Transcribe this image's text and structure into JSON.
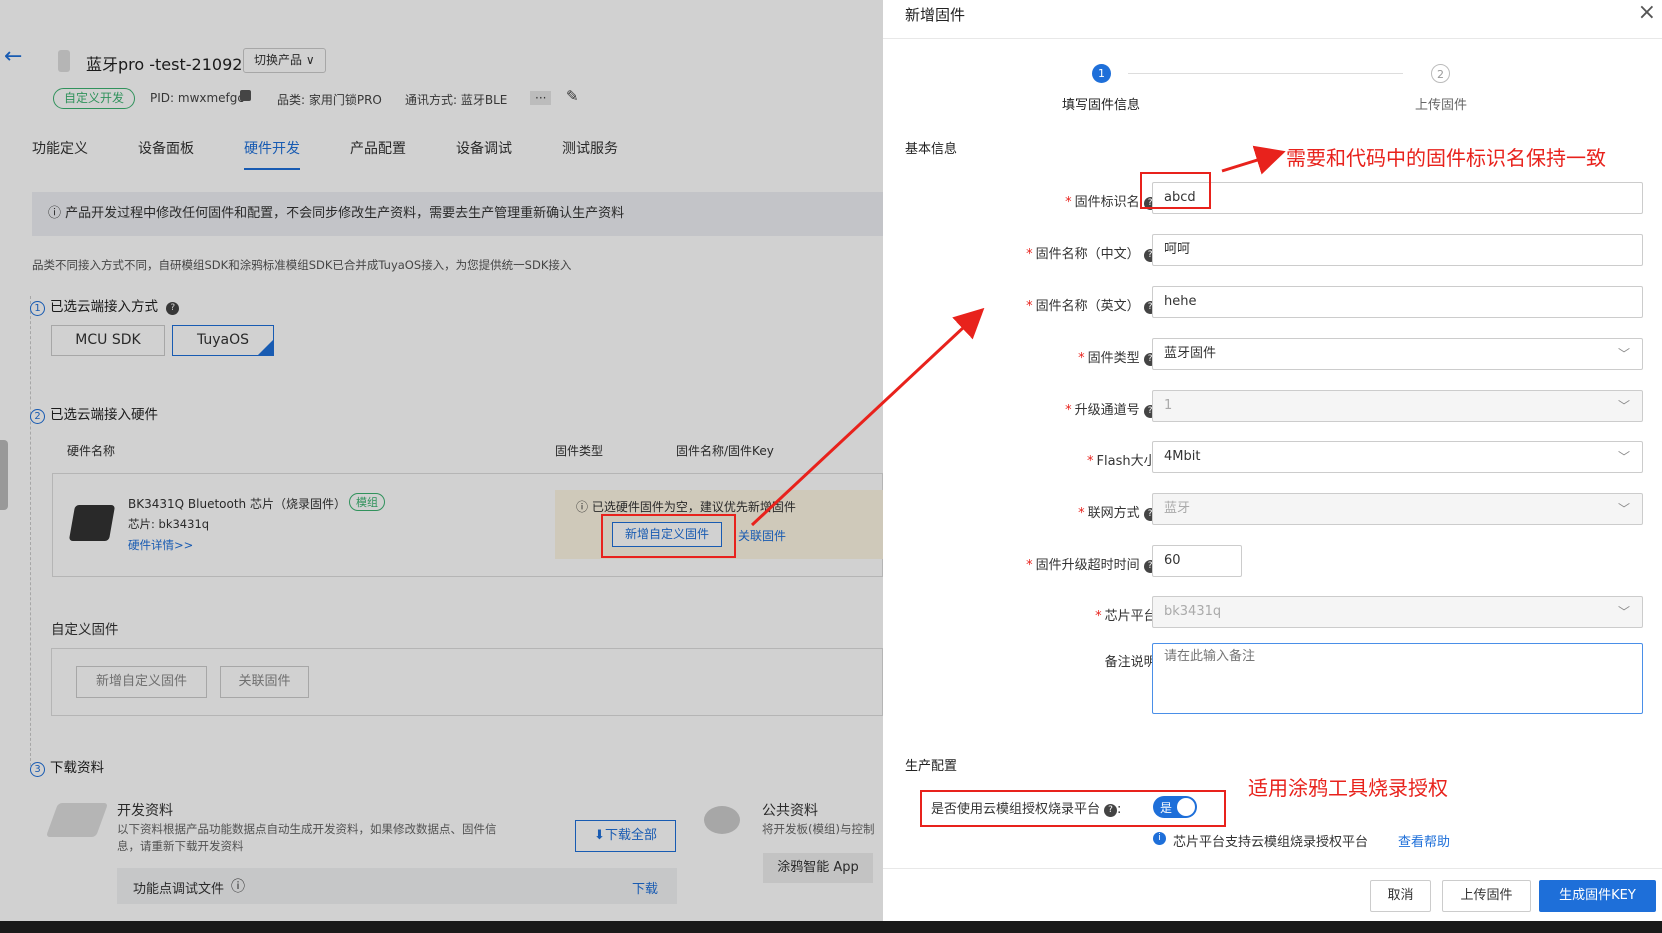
{
  "product": {
    "title": "蓝牙pro -test-210927",
    "switch_label": "切换产品 ∨",
    "tag": "自定义开发",
    "pid": "PID: mwxmefgc",
    "category": "品类: 家用门锁PRO",
    "comm": "通讯方式: 蓝牙BLE",
    "more": "···"
  },
  "tabs": [
    "功能定义",
    "设备面板",
    "硬件开发",
    "产品配置",
    "设备调试",
    "测试服务"
  ],
  "notice": "产品开发过程中修改任何固件和配置，不会同步修改生产资料，需要去生产管理重新确认生产资料",
  "subtitle": "品类不同接入方式不同，自研模组SDK和涂鸦标准模组SDK已合并成TuyaOS接入，为您提供统一SDK接入",
  "step1": {
    "num": "1",
    "label": "已选云端接入方式",
    "options": [
      "MCU SDK",
      "TuyaOS"
    ]
  },
  "step2": {
    "num": "2",
    "label": "已选云端接入硬件",
    "cols": [
      "硬件名称",
      "固件类型",
      "固件名称/固件Key"
    ],
    "hw": {
      "name": "BK3431Q Bluetooth 芯片（烧录固件）",
      "tag": "模组",
      "chip": "芯片: bk3431q",
      "detail": "硬件详情>>"
    },
    "warn": "已选硬件固件为空，建议优先新增固件",
    "add_btn": "新增自定义固件",
    "link_btn": "关联固件"
  },
  "custom": {
    "label": "自定义固件",
    "add_btn": "新增自定义固件",
    "link_btn": "关联固件"
  },
  "step3": {
    "num": "3",
    "label": "下载资料",
    "dev_title": "开发资料",
    "dev_desc1": "以下资料根据产品功能数据点自动生成开发资料，如果修改数据点、固件信",
    "dev_desc2": "息，请重新下载开发资料",
    "download_all": "⬇下载全部",
    "pub_title": "公共资料",
    "pub_desc": "将开发板(模组)与控制",
    "app": "涂鸦智能 App",
    "row_label": "功能点调试文件",
    "row_dl": "下载"
  },
  "modal": {
    "title": "新增固件",
    "close": "×",
    "steps": [
      {
        "num": "1",
        "label": "填写固件信息"
      },
      {
        "num": "2",
        "label": "上传固件"
      }
    ],
    "section1": "基本信息",
    "fields": [
      {
        "label": "固件标识名",
        "value": "abcd",
        "req": true,
        "help": true,
        "type": "input"
      },
      {
        "label": "固件名称（中文）",
        "value": "呵呵",
        "req": true,
        "help": true,
        "type": "input"
      },
      {
        "label": "固件名称（英文）",
        "value": "hehe",
        "req": true,
        "help": true,
        "type": "input"
      },
      {
        "label": "固件类型",
        "value": "蓝牙固件",
        "req": true,
        "help": true,
        "type": "select"
      },
      {
        "label": "升级通道号",
        "value": "1",
        "req": true,
        "help": true,
        "type": "select-dis"
      },
      {
        "label": "Flash大小",
        "value": "4Mbit",
        "req": true,
        "help": false,
        "type": "select"
      },
      {
        "label": "联网方式",
        "value": "蓝牙",
        "req": true,
        "help": true,
        "type": "select-dis"
      },
      {
        "label": "固件升级超时时间",
        "value": "60",
        "req": true,
        "help": true,
        "type": "short"
      },
      {
        "label": "芯片平台",
        "value": "bk3431q",
        "req": true,
        "help": false,
        "type": "select-dis"
      }
    ],
    "remark_label": "备注说明",
    "remark_placeholder": "请在此输入备注",
    "section2": "生产配置",
    "auth_label": "是否使用云模组授权烧录平台",
    "toggle": "是",
    "auth_info": "芯片平台支持云模组烧录授权平台",
    "help_link": "查看帮助",
    "buttons": {
      "cancel": "取消",
      "upload": "上传固件",
      "generate": "生成固件KEY"
    }
  },
  "annotations": {
    "a1": "需要和代码中的固件标识名保持一致",
    "a2": "适用涂鸦工具烧录授权"
  },
  "colors": {
    "primary": "#1e6fd9",
    "annotation": "#e8221c",
    "green": "#3cb371"
  }
}
